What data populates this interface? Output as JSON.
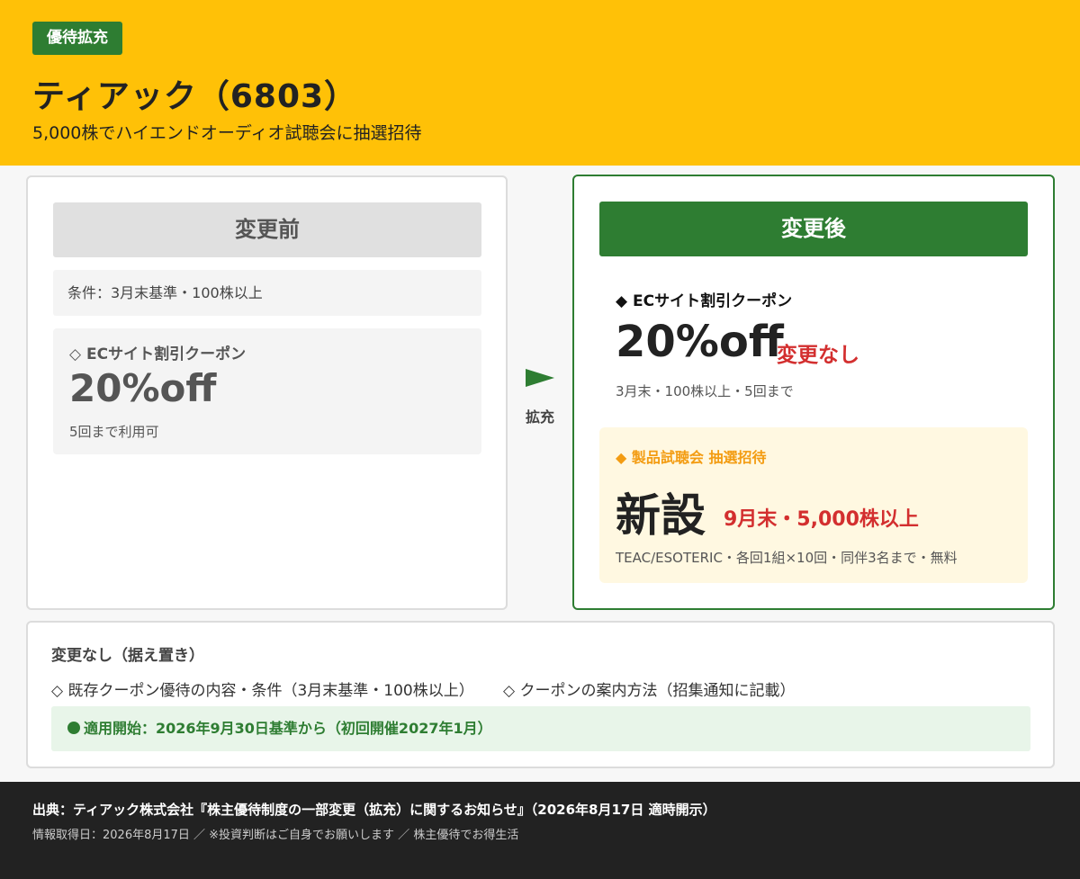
{
  "header": {
    "badge": "優待拡充",
    "title": "ティアック（6803）",
    "subtitle": "5,000株でハイエンドオーディオ試聴会に抽選招待",
    "bg_color": "#ffc107"
  },
  "before": {
    "heading": "変更前",
    "condition": "条件：3月末基準・100株以上",
    "coupon_label": "◇ ECサイト割引クーポン",
    "coupon_value": "20%off",
    "coupon_note": "5回まで利用可"
  },
  "transition": {
    "label": "拡充",
    "icon": "arrow-right-icon"
  },
  "after": {
    "heading": "変更後",
    "ec_label": "◆ ECサイト割引クーポン",
    "ec_value": "20%off",
    "ec_status": "変更なし",
    "ec_note": "3月末・100株以上・5回まで",
    "new_label": "◆ 製品試聴会 抽選招待",
    "new_value": "新設",
    "new_condition": "9月末・5,000株以上",
    "new_note": "TEAC/ESOTERIC・各回1組×10回・同伴3名まで・無料",
    "accent_color": "#2e7d32"
  },
  "unchanged": {
    "title": "変更なし（据え置き）",
    "items": [
      "◇ 既存クーポン優待の内容・条件（3月末基準・100株以上）",
      "◇ クーポンの案内方法（招集通知に記載）"
    ],
    "start": "適用開始：2026年9月30日基準から（初回開催2027年1月）"
  },
  "footer": {
    "source": "出典：ティアック株式会社『株主優待制度の一部変更（拡充）に関するお知らせ』（2026年8月17日 適時開示）",
    "info": "情報取得日：2026年8月17日 ／ ※投資判断はご自身でお願いします ／ 株主優待でお得生活"
  }
}
